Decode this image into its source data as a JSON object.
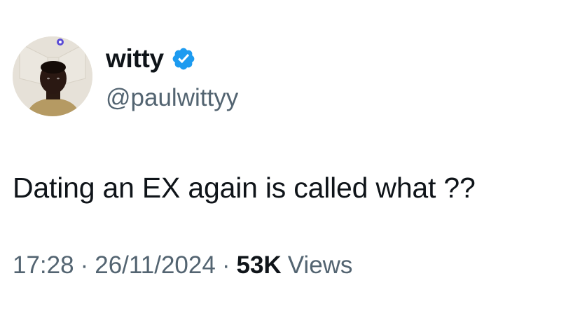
{
  "author": {
    "display_name": "witty",
    "handle": "@paulwittyy",
    "verified": true,
    "avatar_icon": "profile-photo"
  },
  "tweet": {
    "text": "Dating an EX again is called what ??"
  },
  "meta": {
    "time": "17:28",
    "separator": "·",
    "date": "26/11/2024",
    "views_count": "53K",
    "views_label": "Views"
  },
  "colors": {
    "text_primary": "#0f1419",
    "text_secondary": "#536471",
    "verified_blue": "#1d9bf0",
    "background": "#ffffff"
  }
}
